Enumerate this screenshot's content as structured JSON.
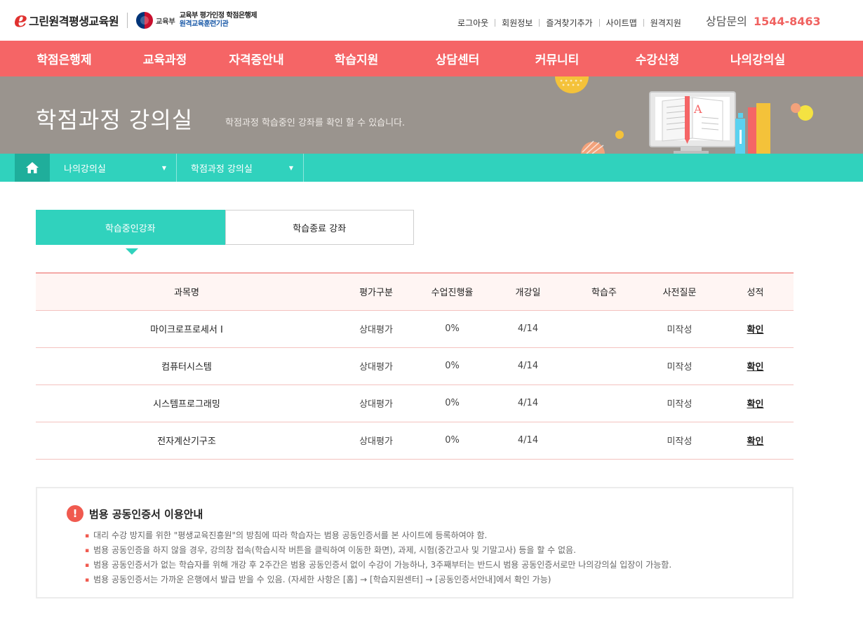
{
  "header": {
    "logo_mark": "e",
    "logo_text": "그린원격평생교육원",
    "moe_name": "교육부",
    "moe_line1": "교육부 평가인정 학점은행제",
    "moe_line2": "원격교육훈련기관",
    "util_links": [
      "로그아웃",
      "회원정보",
      "즐겨찾기추가",
      "사이트맵",
      "원격지원"
    ],
    "counsel_label": "상담문의",
    "counsel_number": "1544-8463"
  },
  "gnb": [
    "학점은행제",
    "교육과정",
    "자격증안내",
    "학습지원",
    "상담센터",
    "커뮤니티",
    "수강신청",
    "나의강의실"
  ],
  "banner": {
    "title": "학점과정 강의실",
    "subtitle": "학점과정 학습중인 강좌를 확인 할 수 있습니다.",
    "book_letter": "A"
  },
  "location": {
    "home_icon": "home-icon",
    "items": [
      {
        "label": "나의강의실"
      },
      {
        "label": "학점과정 강의실"
      }
    ]
  },
  "tabs": [
    {
      "label": "학습중인강좌",
      "active": true
    },
    {
      "label": "학습종료 강좌",
      "active": false
    }
  ],
  "table": {
    "headers": [
      "과목명",
      "평가구분",
      "수업진행율",
      "개강일",
      "학습주",
      "사전질문",
      "성적"
    ],
    "rows": [
      {
        "name": "마이크로프로세서 I",
        "eval": "상대평가",
        "progress": "0%",
        "start": "4/14",
        "week": "",
        "prequestion": "미작성",
        "grade": "확인"
      },
      {
        "name": "컴퓨터시스템",
        "eval": "상대평가",
        "progress": "0%",
        "start": "4/14",
        "week": "",
        "prequestion": "미작성",
        "grade": "확인"
      },
      {
        "name": "시스템프로그래밍",
        "eval": "상대평가",
        "progress": "0%",
        "start": "4/14",
        "week": "",
        "prequestion": "미작성",
        "grade": "확인"
      },
      {
        "name": "전자계산기구조",
        "eval": "상대평가",
        "progress": "0%",
        "start": "4/14",
        "week": "",
        "prequestion": "미작성",
        "grade": "확인"
      }
    ]
  },
  "notice": {
    "icon": "!",
    "title": "범용 공동인증서 이용안내",
    "items": [
      "대리 수강 방지를 위한 \"평생교육진흥원\"의 방침에 따라 학습자는 범용 공동인증서를 본 사이트에 등록하여야 함.",
      "범용 공동인증을 하지 않을 경우, 강의창 접속(학습시작 버튼을 클릭하여 이동한 화면), 과제, 시험(중간고사 및 기말고사) 등을 할 수 없음.",
      "범용 공동인증서가 없는 학습자를 위해 개강 후 2주간은 범용 공동인증서 없이 수강이 가능하나, 3주째부터는 반드시 범용 공동인증서로만 나의강의실 입장이 가능함.",
      "범용 공동인증서는 가까운 은행에서 발급 받을 수 있음. (자세한 사항은 [홈] → [학습지원센터] → [공동인증서안내]에서 확인 가능)"
    ]
  },
  "colors": {
    "gnb": "#f56566",
    "accent": "#30d2bd",
    "banner": "#9a948e",
    "counsel": "#f06260"
  }
}
